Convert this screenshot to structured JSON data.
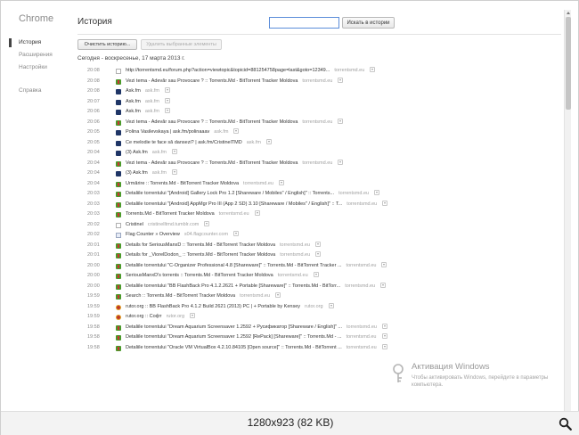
{
  "sidebar": {
    "brand": "Chrome",
    "items": [
      {
        "label": "История",
        "active": true
      },
      {
        "label": "Расширения",
        "active": false
      },
      {
        "label": "Настройки",
        "active": false
      }
    ],
    "help": "Справка"
  },
  "header": {
    "title": "История",
    "search_placeholder": "",
    "search_button": "Искать в истории"
  },
  "toolbar": {
    "clear_label": "Очистить историю...",
    "remove_label": "Удалить выбранные элементы"
  },
  "day_header": "Сегодня - воскресенье, 17 марта 2013 г.",
  "entries": [
    {
      "time": "20:08",
      "icon": "doc",
      "title": "http://torrentsmd.eu/forum.php?action=viewtopic&topicid=881254758page=last&goto=12349...",
      "domain": "torrentsmd.eu"
    },
    {
      "time": "20:08",
      "icon": "torrent",
      "title": "Vezi tema - Adevăr sau Provocare ? :: Torrents.Md - BitTorrent Tracker Moldova",
      "domain": "torrentsmd.eu"
    },
    {
      "time": "20:08",
      "icon": "ask",
      "title": "Ask.fm",
      "domain": "ask.fm"
    },
    {
      "time": "20:07",
      "icon": "ask",
      "title": "Ask.fm",
      "domain": "ask.fm"
    },
    {
      "time": "20:06",
      "icon": "ask",
      "title": "Ask.fm",
      "domain": "ask.fm"
    },
    {
      "time": "20:06",
      "icon": "torrent",
      "title": "Vezi tema - Adevăr sau Provocare ? :: Torrents.Md - BitTorrent Tracker Moldova",
      "domain": "torrentsmd.eu"
    },
    {
      "time": "20:05",
      "icon": "ask",
      "title": "Polina Vasilevskaya | ask.fm/polinaaav",
      "domain": "ask.fm"
    },
    {
      "time": "20:05",
      "icon": "ask",
      "title": "Ce melodie te face să dansezi? | ask.fm/CristinelTMD",
      "domain": "ask.fm"
    },
    {
      "time": "20:04",
      "icon": "ask",
      "title": "(3) Ask.fm",
      "domain": "ask.fm"
    },
    {
      "time": "20:04",
      "icon": "torrent",
      "title": "Vezi tema - Adevăr sau Provocare ? :: Torrents.Md - BitTorrent Tracker Moldova",
      "domain": "torrentsmd.eu"
    },
    {
      "time": "20:04",
      "icon": "ask",
      "title": "(3) Ask.fm",
      "domain": "ask.fm"
    },
    {
      "time": "20:04",
      "icon": "torrent",
      "title": "Urmărire :: Torrents.Md - BitTorrent Tracker Moldova",
      "domain": "torrentsmd.eu"
    },
    {
      "time": "20:03",
      "icon": "torrent",
      "title": "Detaliile torrentului \"[Android] Gallery Lock Pro 1.2 [Shareware / Mobiles\" / English]\" :: Torrents...",
      "domain": "torrentsmd.eu"
    },
    {
      "time": "20:03",
      "icon": "torrent",
      "title": "Detaliile torrentului \"[Android] AppMgr Pro III (App 2 SD) 3.10 [Shareware / Mobiles\" / English]\" :: T...",
      "domain": "torrentsmd.eu"
    },
    {
      "time": "20:03",
      "icon": "torrent",
      "title": "Torrents.Md - BitTorrent Tracker Moldova",
      "domain": "torrentsmd.eu"
    },
    {
      "time": "20:02",
      "icon": "doc",
      "title": "Cristinel",
      "domain": "cristinelltmd.tumblr.com"
    },
    {
      "time": "20:02",
      "icon": "flag",
      "title": "Flag Counter » Overview",
      "domain": "s04.flagcounter.com"
    },
    {
      "time": "20:01",
      "icon": "torrent",
      "title": "Details for SeriousManxD :: Torrents.Md - BitTorrent Tracker Moldova",
      "domain": "torrentsmd.eu"
    },
    {
      "time": "20:01",
      "icon": "torrent",
      "title": "Details for _ViorelDodon_ :: Torrents.Md - BitTorrent Tracker Moldova",
      "domain": "torrentsmd.eu"
    },
    {
      "time": "20:00",
      "icon": "torrent",
      "title": "Detaliile torrentului \"C-Organizer Professional 4.8 [Shareware]\" :: Torrents.Md - BitTorrent Tracker ...",
      "domain": "torrentsmd.eu"
    },
    {
      "time": "20:00",
      "icon": "torrent",
      "title": "SeriousManxD's torrents :: Torrents.Md - BitTorrent Tracker Moldova",
      "domain": "torrentsmd.eu"
    },
    {
      "time": "20:00",
      "icon": "torrent",
      "title": "Detaliile torrentului \"BB FlashBack Pro 4.1.2.2621 + Portable [Shareware]\" :: Torrents.Md - BitTorr...",
      "domain": "torrentsmd.eu"
    },
    {
      "time": "19:59",
      "icon": "torrent",
      "title": "Search :: Torrents.Md - BitTorrent Tracker Moldova",
      "domain": "torrentsmd.eu"
    },
    {
      "time": "19:59",
      "icon": "rutor",
      "title": "rutor.org :: BB FlashBack Pro 4.1.2 Build 2621 (2013) PC | + Portable by Kensey",
      "domain": "rutor.org"
    },
    {
      "time": "19:59",
      "icon": "rutor",
      "title": "rutor.org :: Софт",
      "domain": "rutor.org"
    },
    {
      "time": "19:58",
      "icon": "torrent",
      "title": "Detaliile torrentului \"Dream Aquarium Screensaver 1.2592 + Русификатор [Shareware / English]\" ...",
      "domain": "torrentsmd.eu"
    },
    {
      "time": "19:58",
      "icon": "torrent",
      "title": "Detaliile torrentului \"Dream Aquarium Screensaver 1.2592 [RePack] [Shareware]\" :: Torrents.Md - ...",
      "domain": "torrentsmd.eu"
    },
    {
      "time": "19:58",
      "icon": "torrent",
      "title": "Detaliile torrentului \"Oracle VM VirtualBox 4.2.10.84105 [Open source]\" :: Torrents.Md - BitTorrent ...",
      "domain": "torrentsmd.eu"
    }
  ],
  "watermark": {
    "title": "Активация Windows",
    "subtitle": "Чтобы активировать Windows, перейдите в параметры компьютера."
  },
  "caption": "1280x923 (82 KB)"
}
